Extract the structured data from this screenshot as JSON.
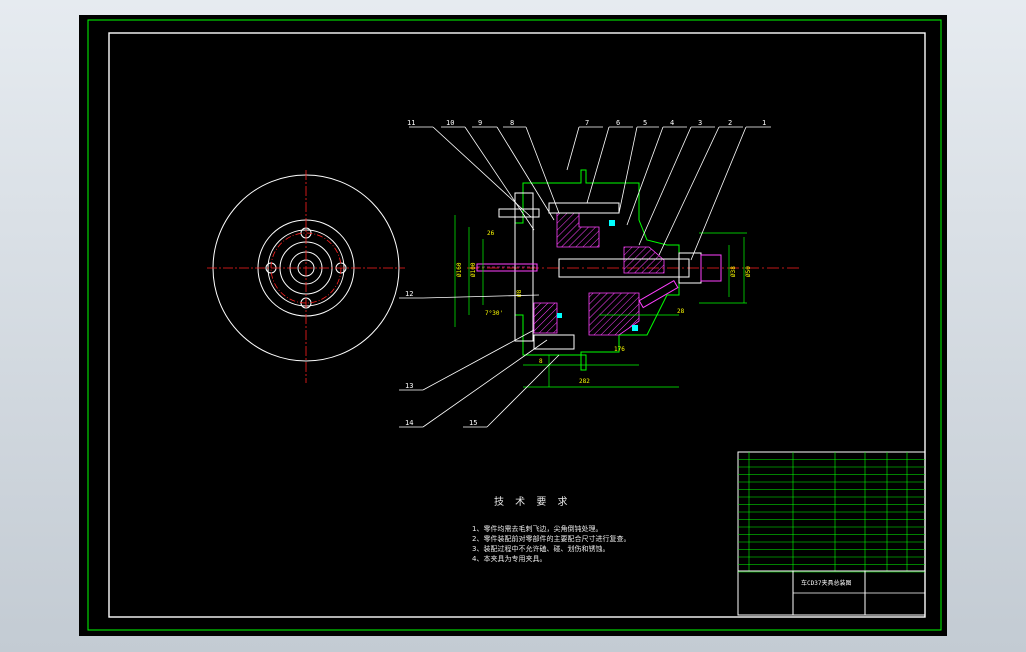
{
  "notes": {
    "title": "技 术 要 求",
    "lines": [
      "1、零件均需去毛刺飞边，尖角倒钝处理。",
      "2、零件装配前对零部件的主要配合尺寸进行复查。",
      "3、装配过程中不允许磕、碰、划伤和锈蚀。",
      "4、本夹具为专用夹具。"
    ]
  },
  "balloons": [
    "11",
    "10",
    "9",
    "8",
    "7",
    "6",
    "5",
    "4",
    "3",
    "2",
    "1",
    "12",
    "13",
    "14",
    "15"
  ],
  "title_block": {
    "drawing_title": "车CD37夹具总装图"
  },
  "colors": {
    "outline": "#00ff00",
    "centerline": "#ff2020",
    "part": "#ff40ff",
    "hatch": "#ff40ff",
    "text": "#ffffff",
    "dim": "#ffff00",
    "cyan": "#00ffff"
  }
}
